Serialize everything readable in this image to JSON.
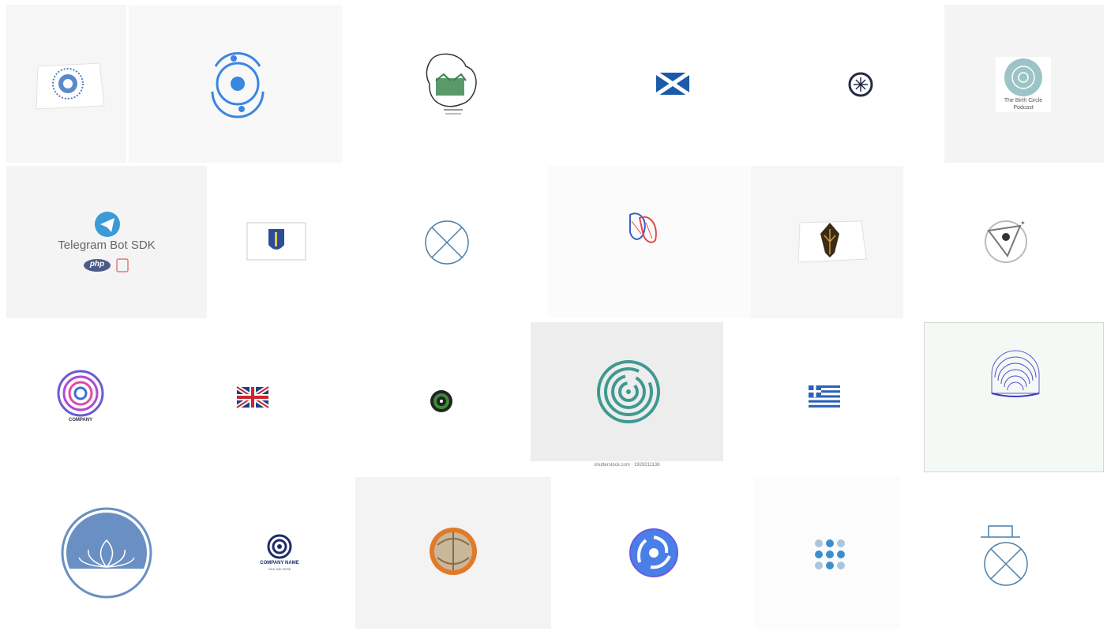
{
  "grid": {
    "tiles": [
      {
        "icon": "greeting-card-circle-icon",
        "bg": "#f6f6f6"
      },
      {
        "icon": "orbit-atom-icon",
        "bg": "#f8f8f8"
      },
      {
        "icon": "sketch-emblem-icon",
        "bg": "#ffffff"
      },
      {
        "icon": "scotland-flag-icon",
        "bg": "#ffffff"
      },
      {
        "icon": "compass-icon",
        "bg": "#ffffff"
      },
      {
        "icon": "circle-podcast-icon",
        "bg": "#f4f4f4",
        "caption_line1": "The Birth Circle",
        "caption_line2": "Podcast"
      },
      {
        "icon": "telegram-icon",
        "bg": "#f4f4f4",
        "title": "Telegram Bot SDK",
        "badge": "php"
      },
      {
        "icon": "massachusetts-flag-icon",
        "bg": "#ffffff"
      },
      {
        "icon": "crossed-circle-icon",
        "bg": "#ffffff"
      },
      {
        "icon": "patterned-leaves-icon",
        "bg": "#fbfbfb"
      },
      {
        "icon": "wheat-card-icon",
        "bg": "#f6f6f6"
      },
      {
        "icon": "eye-triangle-icon",
        "bg": "#ffffff"
      },
      {
        "icon": "concentric-circle-logo-icon",
        "bg": "#ffffff",
        "label": "COMPANY"
      },
      {
        "icon": "uk-flag-icon",
        "bg": "#ffffff"
      },
      {
        "icon": "target-dot-icon",
        "bg": "#ffffff"
      },
      {
        "icon": "maze-circle-icon",
        "bg": "#ededed",
        "footer": "shutterstock.com · 1928211138"
      },
      {
        "icon": "greece-flag-icon",
        "bg": "#ffffff"
      },
      {
        "icon": "arches-line-icon",
        "bg": "#f4f9f5"
      },
      {
        "icon": "lotus-circle-icon",
        "bg": "#ffffff"
      },
      {
        "icon": "company-swirl-logo-icon",
        "bg": "#ffffff",
        "label": "COMPANY NAME",
        "sublabel": "TAGLINE HERE"
      },
      {
        "icon": "sphere-photo-icon",
        "bg": "#f3f3f3"
      },
      {
        "icon": "spiral-circle-icon",
        "bg": "#ffffff"
      },
      {
        "icon": "dots-grid-icon",
        "bg": "#fcfcfc"
      },
      {
        "icon": "circle-x-pedestal-icon",
        "bg": "#ffffff"
      }
    ]
  }
}
